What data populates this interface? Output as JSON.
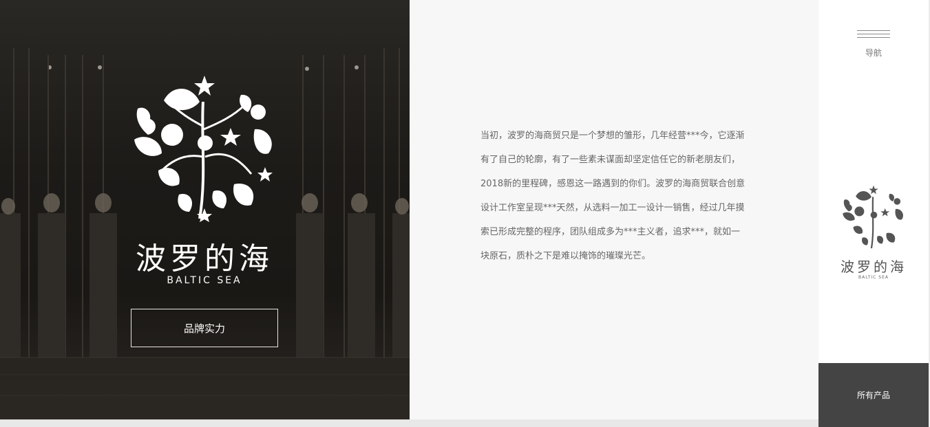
{
  "hero": {
    "brand_cn": "波罗的海",
    "brand_en": "BALTIC SEA",
    "button_label": "品牌实力"
  },
  "intro": {
    "paragraph": "当初，波罗的海商贸只是一个梦想的雏形，几年经营***今，它逐渐有了自己的轮廓，有了一些素未谋面却坚定信任它的新老朋友们，2018新的里程碑，感恩这一路遇到的你们。波罗的海商贸联合创意设计工作室呈现***天然，从选料一加工一设计一销售，经过几年摸索已形成完整的程序，团队组成多为***主义者，追求***，就如一块原石，质朴之下是难以掩饰的璀璨光芒。"
  },
  "sidebar": {
    "nav_label": "导航",
    "brand_cn": "波罗的海",
    "brand_en": "BALTIC SEA",
    "all_products_label": "所有产品"
  },
  "colors": {
    "hero_bg": "#1d1b18",
    "intro_bg": "#f7f7f7",
    "sidebar_bg": "#ffffff",
    "products_bg": "#444444"
  },
  "icons": {
    "menu": "hamburger-icon",
    "logo": "floral-logo-icon"
  }
}
